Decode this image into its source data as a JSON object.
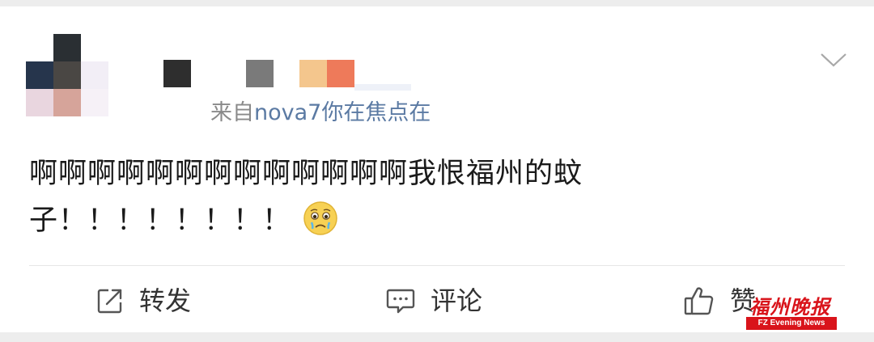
{
  "post": {
    "source_prefix": "来自",
    "source_device": "nova7你在焦点在",
    "content_line1": "啊啊啊啊啊啊啊啊啊啊啊啊啊我恨福州的蚊",
    "content_line2": "子！！！！！！！！",
    "emoji": "crying-face"
  },
  "actions": {
    "repost_label": "转发",
    "comment_label": "评论",
    "like_label": "赞"
  },
  "watermark": {
    "title": "福州晚报",
    "subtitle": "FZ Evening News"
  },
  "colors": {
    "link": "#5b7aa3",
    "text": "#1a1a1a",
    "muted": "#8a8a8a",
    "brand": "#d9141b"
  }
}
